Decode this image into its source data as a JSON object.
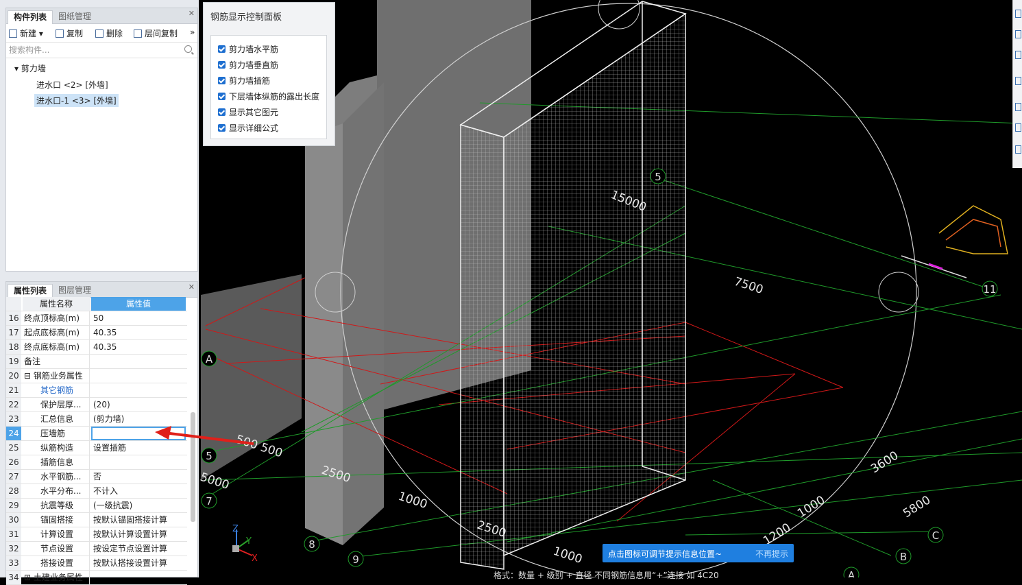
{
  "component_panel": {
    "tabs": [
      "构件列表",
      "图纸管理"
    ],
    "toolbar": {
      "new": "新建",
      "copy": "复制",
      "delete": "删除",
      "floor_copy": "层间复制",
      "more": "»"
    },
    "search_placeholder": "搜索构件...",
    "tree": {
      "group": "剪力墙",
      "items": [
        "进水口 <2> [外墙]",
        "进水口-1 <3> [外墙]"
      ]
    }
  },
  "property_panel": {
    "tabs": [
      "属性列表",
      "图层管理"
    ],
    "header": {
      "name": "属性名称",
      "value": "属性值"
    },
    "rows": [
      {
        "n": "16",
        "name": "终点顶标高(m)",
        "value": "50"
      },
      {
        "n": "17",
        "name": "起点底标高(m)",
        "value": "40.35"
      },
      {
        "n": "18",
        "name": "终点底标高(m)",
        "value": "40.35"
      },
      {
        "n": "19",
        "name": "备注",
        "value": ""
      },
      {
        "n": "20",
        "name": "⊟ 钢筋业务属性",
        "value": ""
      },
      {
        "n": "21",
        "name": "其它钢筋",
        "value": ""
      },
      {
        "n": "22",
        "name": "保护层厚...",
        "value": "(20)"
      },
      {
        "n": "23",
        "name": "汇总信息",
        "value": "(剪力墙)"
      },
      {
        "n": "24",
        "name": "压墙筋",
        "value": ""
      },
      {
        "n": "25",
        "name": "纵筋构造",
        "value": "设置插筋"
      },
      {
        "n": "26",
        "name": "插筋信息",
        "value": ""
      },
      {
        "n": "27",
        "name": "水平钢筋...",
        "value": "否"
      },
      {
        "n": "28",
        "name": "水平分布...",
        "value": "不计入"
      },
      {
        "n": "29",
        "name": "抗震等级",
        "value": "(一级抗震)"
      },
      {
        "n": "30",
        "name": "锚固搭接",
        "value": "按默认锚固搭接计算"
      },
      {
        "n": "31",
        "name": "计算设置",
        "value": "按默认计算设置计算"
      },
      {
        "n": "32",
        "name": "节点设置",
        "value": "按设定节点设置计算"
      },
      {
        "n": "33",
        "name": "搭接设置",
        "value": "按默认搭接设置计算"
      },
      {
        "n": "34",
        "name": "⊞ 土建业务属性",
        "value": ""
      }
    ]
  },
  "control_panel": {
    "title": "钢筋显示控制面板",
    "options": [
      "剪力墙水平筋",
      "剪力墙垂直筋",
      "剪力墙插筋",
      "下层墙体纵筋的露出长度",
      "显示其它图元",
      "显示详细公式"
    ]
  },
  "viewport": {
    "dims": [
      "15000",
      "7500",
      "500 500",
      "2500",
      "1000",
      "2500",
      "1000",
      "3600",
      "5800",
      "1000",
      "1200",
      "5000"
    ],
    "axes": [
      "5",
      "A",
      "5",
      "7",
      "8",
      "9",
      "11",
      "C",
      "B",
      "A"
    ],
    "triad": [
      "Z",
      "Y",
      "X"
    ]
  },
  "tip": {
    "text": "点击图标可调节提示信息位置~",
    "dismiss": "不再提示"
  },
  "status": "格式：数量 + 级别 + 直径 不同钢筋信息用“+”连接 如 4C20"
}
